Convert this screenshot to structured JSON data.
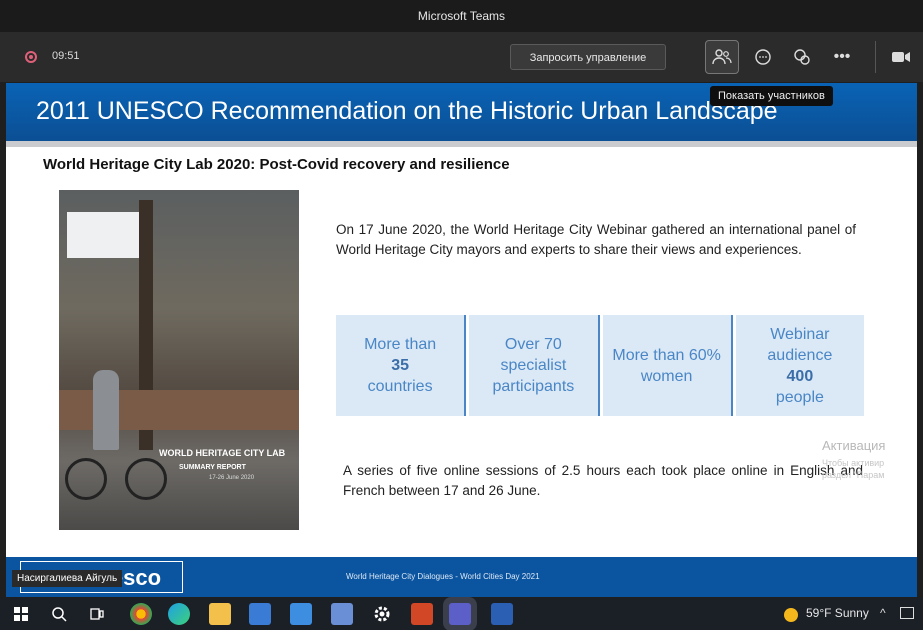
{
  "window": {
    "title": "Microsoft Teams"
  },
  "toolbar": {
    "timer": "09:51",
    "request_control": "Запросить управление",
    "tooltip": "Показать участников"
  },
  "slide": {
    "heading": "2011 UNESCO Recommendation on the Historic Urban Landscape",
    "subtitle": "World Heritage City Lab 2020: Post-Covid recovery and resilience",
    "intro": "On 17 June 2020, the World Heritage City Webinar gathered an international panel of World Heritage City mayors and experts to share their views and experiences.",
    "stats": [
      {
        "line1": "More than",
        "line2": "35",
        "line3": "countries"
      },
      {
        "line1": "Over 70",
        "line2": "specialist",
        "line3": "participants"
      },
      {
        "line1": "More than 60%",
        "line2": "women",
        "line3": ""
      },
      {
        "line1": "Webinar",
        "line2": "audience",
        "line3": "400",
        "line4": "people"
      }
    ],
    "series": "A series of five online sessions of 2.5 hours each took place online in English and French between 17 and 26 June.",
    "photo_caption": {
      "title": "WORLD HERITAGE CITY LAB",
      "line2": "SUMMARY REPORT",
      "line3": "17-26 June 2020"
    },
    "footer_logo": "unesco",
    "footer_text": "World Heritage City Dialogues - World Cities Day 2021",
    "presenter": "Насиргалиева Айгуль"
  },
  "activation": {
    "line1": "Активация",
    "line2": "Чтобы активир",
    "line3": "раздел \"Парам"
  },
  "taskbar": {
    "weather": "59°F  Sunny",
    "chevron": "^"
  },
  "colors": {
    "banner": "#0a63b5",
    "stat_text": "#4a86c6",
    "stat_bg": "#dbe9f6"
  }
}
